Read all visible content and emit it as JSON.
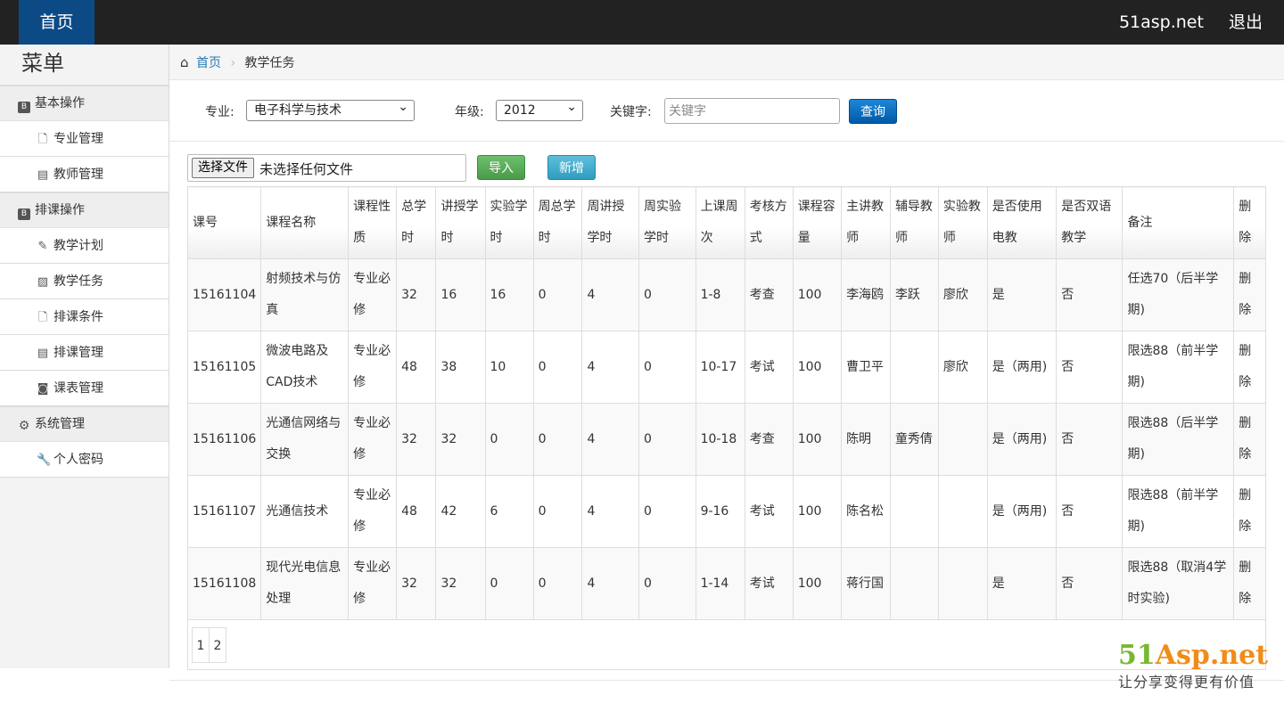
{
  "topbar": {
    "home_label": "首页",
    "site_link": "51asp.net",
    "logout": "退出"
  },
  "sidebar": {
    "title": "菜单",
    "groups": [
      {
        "label": "基本操作",
        "icon": "book-icon",
        "items": [
          {
            "label": "专业管理",
            "icon": "file-icon"
          },
          {
            "label": "教师管理",
            "icon": "list-icon"
          }
        ]
      },
      {
        "label": "排课操作",
        "icon": "book-icon",
        "items": [
          {
            "label": "教学计划",
            "icon": "plug-icon"
          },
          {
            "label": "教学任务",
            "icon": "picture-icon"
          },
          {
            "label": "排课条件",
            "icon": "file-icon"
          },
          {
            "label": "排课管理",
            "icon": "list-icon"
          },
          {
            "label": "课表管理",
            "icon": "binoculars-icon"
          }
        ]
      },
      {
        "label": "系统管理",
        "icon": "gear-icon",
        "items": [
          {
            "label": "个人密码",
            "icon": "wrench-icon"
          }
        ]
      }
    ]
  },
  "breadcrumb": {
    "home": "首页",
    "current": "教学任务"
  },
  "filters": {
    "major_label": "专业:",
    "major_value": "电子科学与技术",
    "grade_label": "年级:",
    "grade_value": "2012",
    "keyword_label": "关键字:",
    "keyword_placeholder": "关键字",
    "query_button": "查询"
  },
  "file": {
    "choose_button": "选择文件",
    "no_file_text": "未选择任何文件",
    "import_button": "导入",
    "add_button": "新增"
  },
  "table": {
    "headers": [
      "课号",
      "课程名称",
      "课程性质",
      "总学时",
      "讲授学时",
      "实验学时",
      "周总学时",
      "周讲授学时",
      "周实验学时",
      "上课周次",
      "考核方式",
      "课程容量",
      "主讲教师",
      "辅导教师",
      "实验教师",
      "是否使用电教",
      "是否双语教学",
      "备注",
      "删除"
    ],
    "rows": [
      [
        "15161104",
        "射频技术与仿真",
        "专业必修",
        "32",
        "16",
        "16",
        "0",
        "4",
        "0",
        "1-8",
        "考查",
        "100",
        "李海鸥",
        "李跃",
        "廖欣",
        "是",
        "否",
        "任选70（后半学期)",
        "删除"
      ],
      [
        "15161105",
        "微波电路及CAD技术",
        "专业必修",
        "48",
        "38",
        "10",
        "0",
        "4",
        "0",
        "10-17",
        "考试",
        "100",
        "曹卫平",
        "",
        "廖欣",
        "是（两用)",
        "否",
        "限选88（前半学期)",
        "删除"
      ],
      [
        "15161106",
        "光通信网络与交换",
        "专业必修",
        "32",
        "32",
        "0",
        "0",
        "4",
        "0",
        "10-18",
        "考查",
        "100",
        "陈明",
        "童秀倩",
        "",
        "是（两用)",
        "否",
        "限选88（后半学期)",
        "删除"
      ],
      [
        "15161107",
        "光通信技术",
        "专业必修",
        "48",
        "42",
        "6",
        "0",
        "4",
        "0",
        "9-16",
        "考试",
        "100",
        "陈名松",
        "",
        "",
        "是（两用)",
        "否",
        "限选88（前半学期)",
        "删除"
      ],
      [
        "15161108",
        "现代光电信息处理",
        "专业必修",
        "32",
        "32",
        "0",
        "0",
        "4",
        "0",
        "1-14",
        "考试",
        "100",
        "蒋行国",
        "",
        "",
        "是",
        "否",
        "限选88（取消4学时实验)",
        "删除"
      ]
    ]
  },
  "pager": {
    "pages": [
      "1",
      "2"
    ]
  },
  "watermark": {
    "logo_a": "51",
    "logo_b": "Asp.net",
    "slogan": "让分享变得更有价值"
  }
}
